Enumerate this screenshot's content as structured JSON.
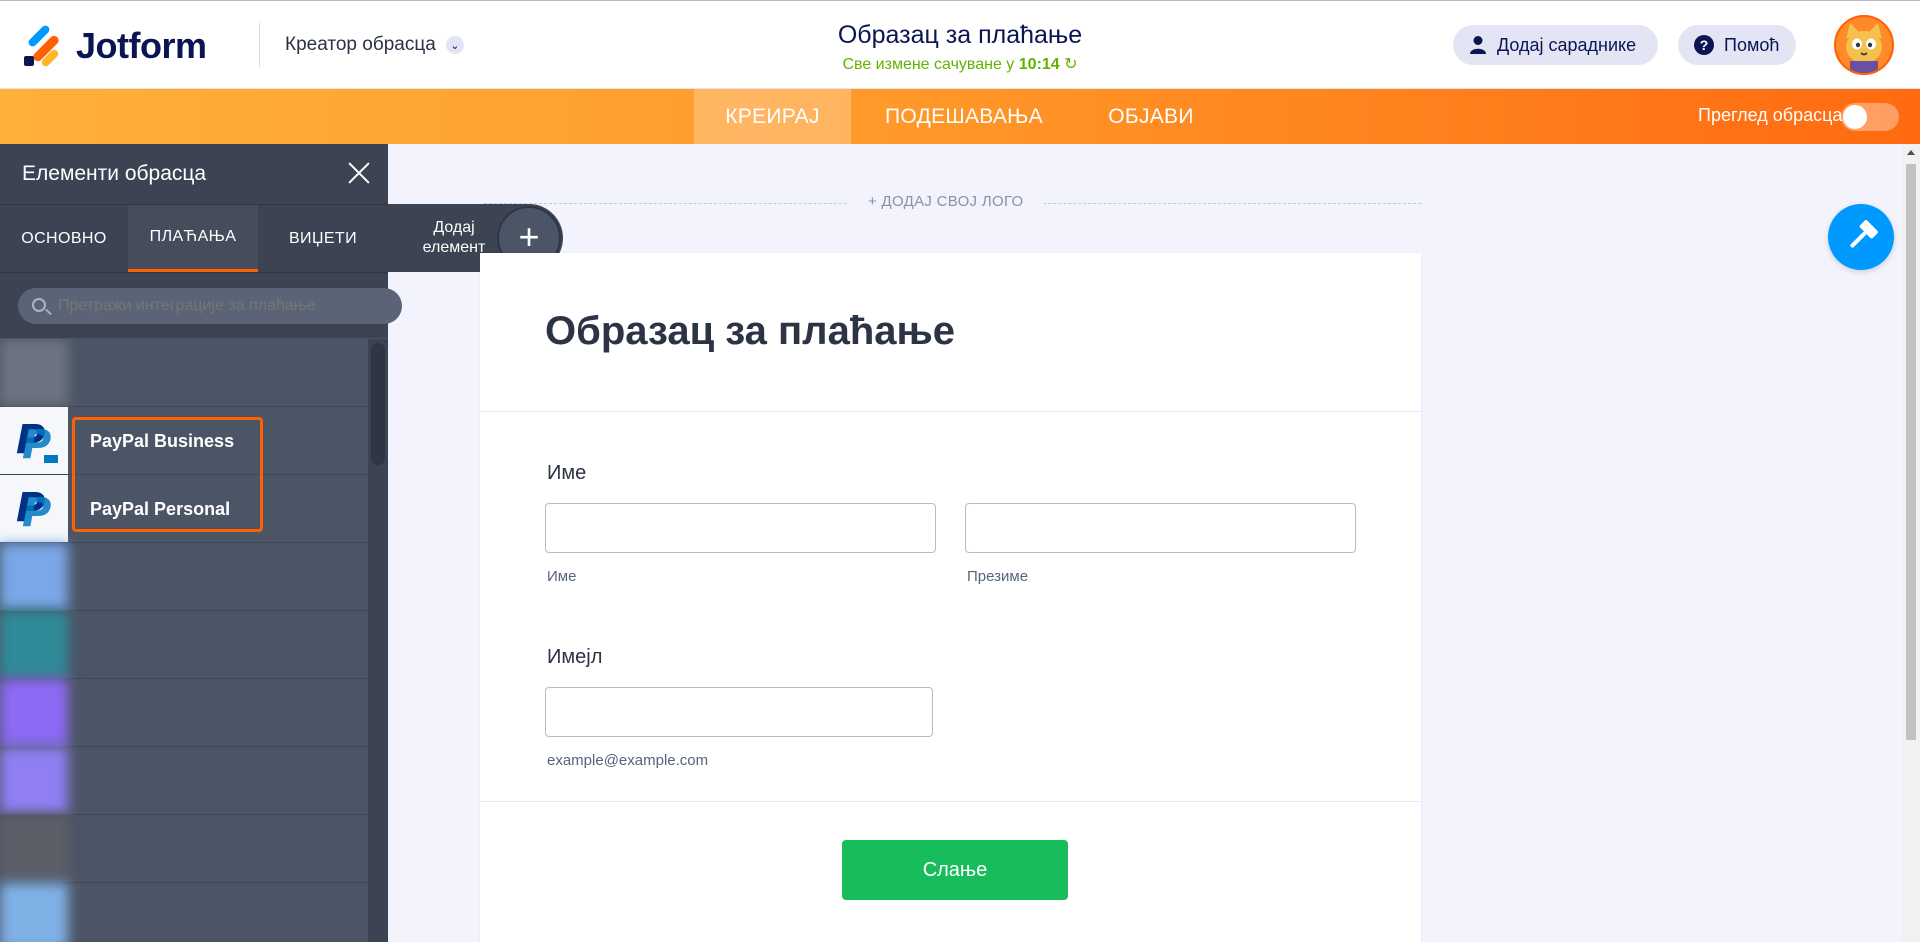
{
  "header": {
    "logo_text": "Jotform",
    "creator_label": "Креатор обрасца",
    "doc_title": "Образац за плаћање",
    "saved_prefix": "Све измене сачуване у",
    "saved_time": "10:14",
    "collab_label": "Додај сараднике",
    "help_label": "Помоћ"
  },
  "nav": {
    "tabs": [
      {
        "label": "КРЕИРАЈ",
        "active": true
      },
      {
        "label": "ПОДЕШАВАЊА",
        "active": false
      },
      {
        "label": "ОБЈАВИ",
        "active": false
      }
    ],
    "preview_label": "Преглед обрасца"
  },
  "sidebar": {
    "title": "Елементи обрасца",
    "tabs": [
      {
        "label": "ОСНОВНО"
      },
      {
        "label": "ПЛАЋАЊА"
      },
      {
        "label": "ВИЏЕТИ"
      }
    ],
    "search_placeholder": "Претражи интеграције за плаћање",
    "items": [
      {
        "label": "PayPal Business"
      },
      {
        "label": "PayPal Personal"
      }
    ]
  },
  "add_element": {
    "label": "Додај елемент",
    "plus": "+"
  },
  "form": {
    "add_logo": "+ ДОДАЈ СВОЈ ЛОГО",
    "title": "Образац за плаћање",
    "name_label": "Име",
    "first_sub": "Име",
    "last_sub": "Презиме",
    "email_label": "Имејл",
    "email_sub": "example@example.com",
    "submit_label": "Слање"
  },
  "colors": {
    "brand_orange": "#ff6100",
    "accent_blue": "#0099ff",
    "submit_green": "#18bd5b",
    "saved_green": "#64b200"
  }
}
